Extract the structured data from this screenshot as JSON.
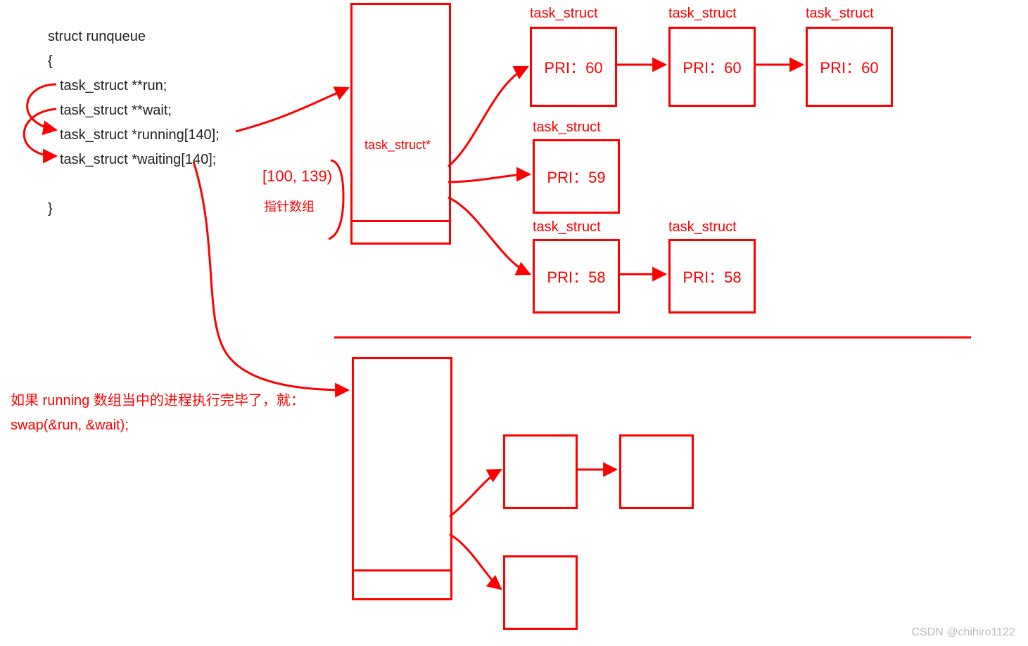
{
  "code": {
    "l1": "struct runqueue",
    "l2": "{",
    "l3": "task_struct **run;",
    "l4": "task_struct **wait;",
    "l5": "task_struct *running[140];",
    "l6": "task_struct *waiting[140];",
    "l7": "}"
  },
  "labels": {
    "task_struct_ptr": "task_struct*",
    "range": "[100, 139)",
    "pointer_array": "指针数组",
    "task_struct": "task_struct"
  },
  "nodes": {
    "pri60": "PRI：60",
    "pri59": "PRI：59",
    "pri58": "PRI：58"
  },
  "note": {
    "line1": "如果 running 数组当中的进程执行完毕了，就：",
    "line2": "swap(&run, &wait);"
  },
  "watermark": "CSDN @chihiro1122"
}
